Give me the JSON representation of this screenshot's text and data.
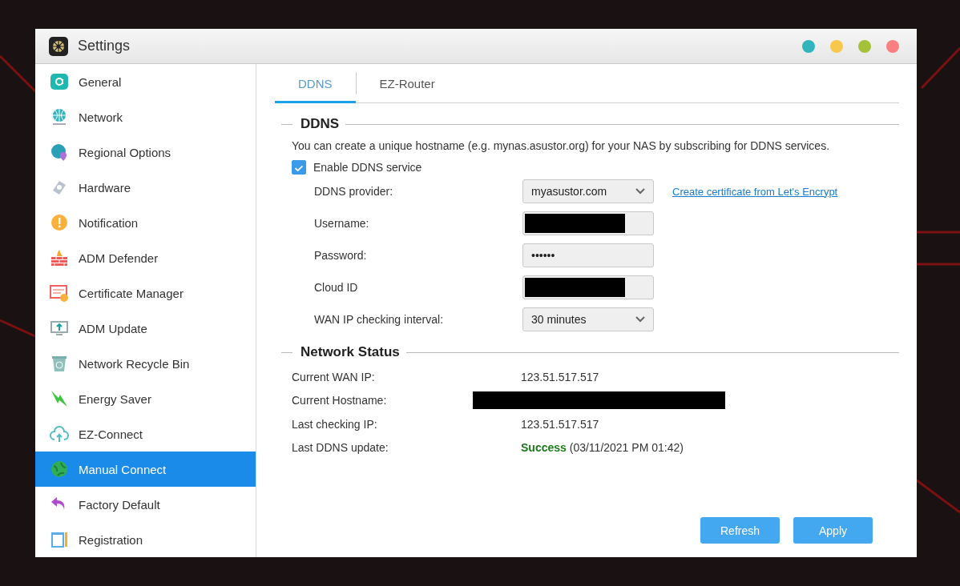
{
  "window": {
    "title": "Settings"
  },
  "sidebar": {
    "items": [
      {
        "label": "General",
        "selected": false
      },
      {
        "label": "Network",
        "selected": false
      },
      {
        "label": "Regional Options",
        "selected": false
      },
      {
        "label": "Hardware",
        "selected": false
      },
      {
        "label": "Notification",
        "selected": false
      },
      {
        "label": "ADM Defender",
        "selected": false
      },
      {
        "label": "Certificate Manager",
        "selected": false
      },
      {
        "label": "ADM Update",
        "selected": false
      },
      {
        "label": "Network Recycle Bin",
        "selected": false
      },
      {
        "label": "Energy Saver",
        "selected": false
      },
      {
        "label": "EZ-Connect",
        "selected": false
      },
      {
        "label": "Manual Connect",
        "selected": true
      },
      {
        "label": "Factory Default",
        "selected": false
      },
      {
        "label": "Registration",
        "selected": false
      }
    ]
  },
  "tabs": [
    {
      "label": "DDNS",
      "selected": true
    },
    {
      "label": "EZ-Router",
      "selected": false
    }
  ],
  "ddns": {
    "heading": "DDNS",
    "description": "You can create a unique hostname (e.g. mynas.asustor.org) for your NAS by subscribing for DDNS services.",
    "enable": {
      "label": "Enable DDNS service",
      "checked": true
    },
    "fields": [
      {
        "label": "DDNS provider:",
        "kind": "select",
        "value": "myasustor.com",
        "link": "Create certificate from Let's Encrypt"
      },
      {
        "label": "Username:",
        "kind": "redacted"
      },
      {
        "label": "Password:",
        "kind": "password",
        "value": "••••••"
      },
      {
        "label": "Cloud ID",
        "kind": "redacted"
      },
      {
        "label": "WAN IP checking interval:",
        "kind": "select",
        "value": "30 minutes"
      }
    ]
  },
  "network_status": {
    "heading": "Network Status",
    "rows": [
      {
        "label": "Current WAN IP:",
        "kind": "text",
        "value": "123.51.517.517"
      },
      {
        "label": "Current Hostname:",
        "kind": "redacted"
      },
      {
        "label": "Last checking IP:",
        "kind": "text",
        "value": "123.51.517.517"
      },
      {
        "label": "Last DDNS update:",
        "kind": "text",
        "value": "**Success** (03/11/2021 PM 01:42)"
      }
    ]
  },
  "buttons": [
    "Refresh",
    "Apply"
  ]
}
